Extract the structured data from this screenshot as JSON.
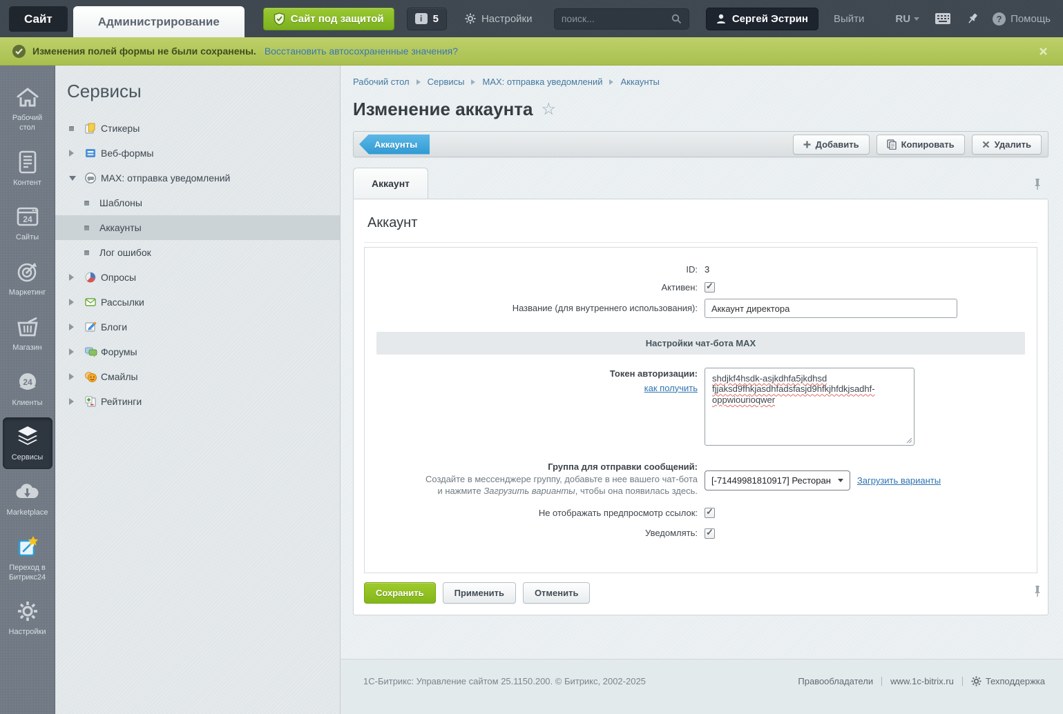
{
  "topbar": {
    "site_tab": "Сайт",
    "admin_tab": "Администрирование",
    "protected_button": "Сайт под защитой",
    "counter_value": "5",
    "info_glyph": "i",
    "settings_label": "Настройки",
    "search_placeholder": "поиск...",
    "user_name": "Сергей Эстрин",
    "logout_label": "Выйти",
    "lang": "RU",
    "help_glyph": "?",
    "help_label": "Помощь"
  },
  "notification": {
    "text": "Изменения полей формы не были сохранены.",
    "link": "Восстановить автосохраненные значения?"
  },
  "rail": {
    "items": [
      {
        "label": "Рабочий стол",
        "icon": "home-icon"
      },
      {
        "label": "Контент",
        "icon": "document-icon"
      },
      {
        "label": "Сайты",
        "icon": "browser-24-icon",
        "badge": "24"
      },
      {
        "label": "Маркетинг",
        "icon": "target-icon"
      },
      {
        "label": "Магазин",
        "icon": "basket-icon"
      },
      {
        "label": "Клиенты",
        "icon": "circle-24-icon",
        "badge": "24"
      },
      {
        "label": "Сервисы",
        "icon": "layers-icon",
        "active": true
      },
      {
        "label": "Marketplace",
        "icon": "cloud-download-icon"
      },
      {
        "label": "Переход в Битрикс24",
        "icon": "bitrix24-icon"
      },
      {
        "label": "Настройки",
        "icon": "gear-icon"
      }
    ]
  },
  "sidebar": {
    "title": "Сервисы",
    "items": [
      {
        "label": "Стикеры",
        "marker": "bullet",
        "icon": "sticker-icon"
      },
      {
        "label": "Веб-формы",
        "marker": "arrow-right",
        "icon": "webform-icon"
      },
      {
        "label": "МАХ: отправка уведомлений",
        "marker": "arrow-down",
        "icon": "chat-icon"
      },
      {
        "label": "Шаблоны",
        "marker": "bullet",
        "indent": 1
      },
      {
        "label": "Аккаунты",
        "marker": "bullet",
        "indent": 1,
        "selected": true
      },
      {
        "label": "Лог ошибок",
        "marker": "bullet",
        "indent": 1
      },
      {
        "label": "Опросы",
        "marker": "arrow-right",
        "icon": "poll-icon"
      },
      {
        "label": "Рассылки",
        "marker": "arrow-right",
        "icon": "mail-icon"
      },
      {
        "label": "Блоги",
        "marker": "arrow-right",
        "icon": "blog-icon"
      },
      {
        "label": "Форумы",
        "marker": "arrow-right",
        "icon": "forum-icon"
      },
      {
        "label": "Смайлы",
        "marker": "arrow-right",
        "icon": "smile-icon"
      },
      {
        "label": "Рейтинги",
        "marker": "arrow-right",
        "icon": "rating-icon"
      }
    ]
  },
  "breadcrumb": {
    "items": [
      "Рабочий стол",
      "Сервисы",
      "МАХ: отправка уведомлений",
      "Аккаунты"
    ]
  },
  "page": {
    "title": "Изменение аккаунта"
  },
  "toolbar": {
    "back_label": "Аккаунты",
    "add_label": "Добавить",
    "copy_label": "Копировать",
    "delete_label": "Удалить"
  },
  "tabs": {
    "account": "Аккаунт"
  },
  "form": {
    "heading": "Аккаунт",
    "id_label": "ID:",
    "id_value": "3",
    "active_label": "Активен:",
    "name_label": "Название (для внутреннего использования):",
    "name_value": "Аккаунт директора",
    "section_header": "Настройки чат-бота MAX",
    "token_label": "Токен авторизации:",
    "token_link": "как получить",
    "token_lines": [
      "shdjkf4hsdk-asjkdhfa5jkdhsd",
      "fjjaksd9fhkjasdhfadsfasjd9hfkjhfdkjsadhf-",
      "oppwiourioqwer"
    ],
    "group_label": "Группа для отправки сообщений:",
    "group_hint_line1": "Создайте в мессенджере группу, добавьте в нее вашего чат-бота",
    "group_hint_2a": "и нажмите ",
    "group_hint_italic": "Загрузить варианты",
    "group_hint_2b": ", чтобы она появилась здесь.",
    "group_value": "[-71449981810917] Ресторан",
    "group_load_link": "Загрузить варианты",
    "preview_label": "Не отображать предпросмотр ссылок:",
    "notify_label": "Уведомлять:"
  },
  "buttons": {
    "save": "Сохранить",
    "apply": "Применить",
    "cancel": "Отменить"
  },
  "footer": {
    "copyright": "1С-Битрикс: Управление сайтом 25.1150.200. © Битрикс, 2002-2025",
    "rights_link": "Правообладатели",
    "site_link": "www.1c-bitrix.ru",
    "support_link": "Техподдержка"
  },
  "colors": {
    "topbar_bg": "#3e474f",
    "accent_green": "#8cbf26",
    "notification_bg": "#b3c75d",
    "link_blue": "#2e73b1",
    "ribbon_blue": "#3ba4da",
    "selected_row": "#ccd3d7"
  }
}
